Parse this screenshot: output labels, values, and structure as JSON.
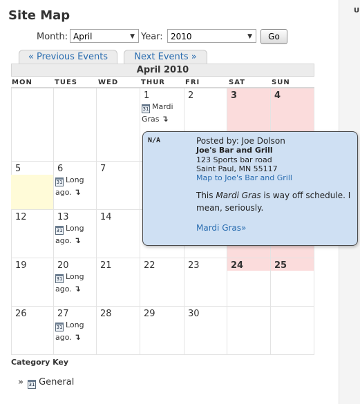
{
  "page": {
    "title": "Site Map",
    "sidebar_letter": "U"
  },
  "filter": {
    "month_label": "Month:",
    "month_value": "April",
    "year_label": "Year:",
    "year_value": "2010",
    "go_label": "Go"
  },
  "nav": {
    "previous_label": "« Previous Events",
    "next_label": "Next Events »"
  },
  "calendar": {
    "caption": "April 2010",
    "weekdays": [
      "MON",
      "TUES",
      "WED",
      "THUR",
      "FRI",
      "SAT",
      "SUN"
    ],
    "weeks": [
      [
        "",
        "",
        "",
        "1",
        "2",
        "3",
        "4"
      ],
      [
        "5",
        "6",
        "7",
        "",
        "",
        "",
        ""
      ],
      [
        "12",
        "13",
        "14",
        "",
        "",
        "",
        ""
      ],
      [
        "19",
        "20",
        "21",
        "22",
        "23",
        "24",
        "25"
      ],
      [
        "26",
        "27",
        "28",
        "29",
        "30",
        "",
        ""
      ]
    ],
    "events": {
      "mardi_gras": {
        "label": "Mardi Gras",
        "icon": "calendar-icon",
        "icon_text": "31",
        "arrow": "↴"
      },
      "long_ago": {
        "label": "Long ago.",
        "icon": "calendar-icon",
        "icon_text": "31",
        "arrow": "↴"
      }
    }
  },
  "popup": {
    "na": "N/A",
    "posted_by": "Posted by: Joe Dolson",
    "venue": "Joe's Bar and Grill",
    "address_line1": "123 Sports bar road",
    "address_line2": "Saint Paul, MN 55117",
    "map_link": "Map to Joe's Bar and Grill",
    "desc_before": "This ",
    "desc_em": "Mardi Gras",
    "desc_after": " is way off schedule. I mean, seriously.",
    "more_link": "Mardi Gras»"
  },
  "category_key": {
    "title": "Category Key",
    "bullet": "»",
    "icon_text": "31",
    "item": "General"
  },
  "colors": {
    "weekend": "#fbdcdc",
    "today": "#fffbd8",
    "popup_bg": "#cfe0f3",
    "link": "#2a6db0"
  }
}
